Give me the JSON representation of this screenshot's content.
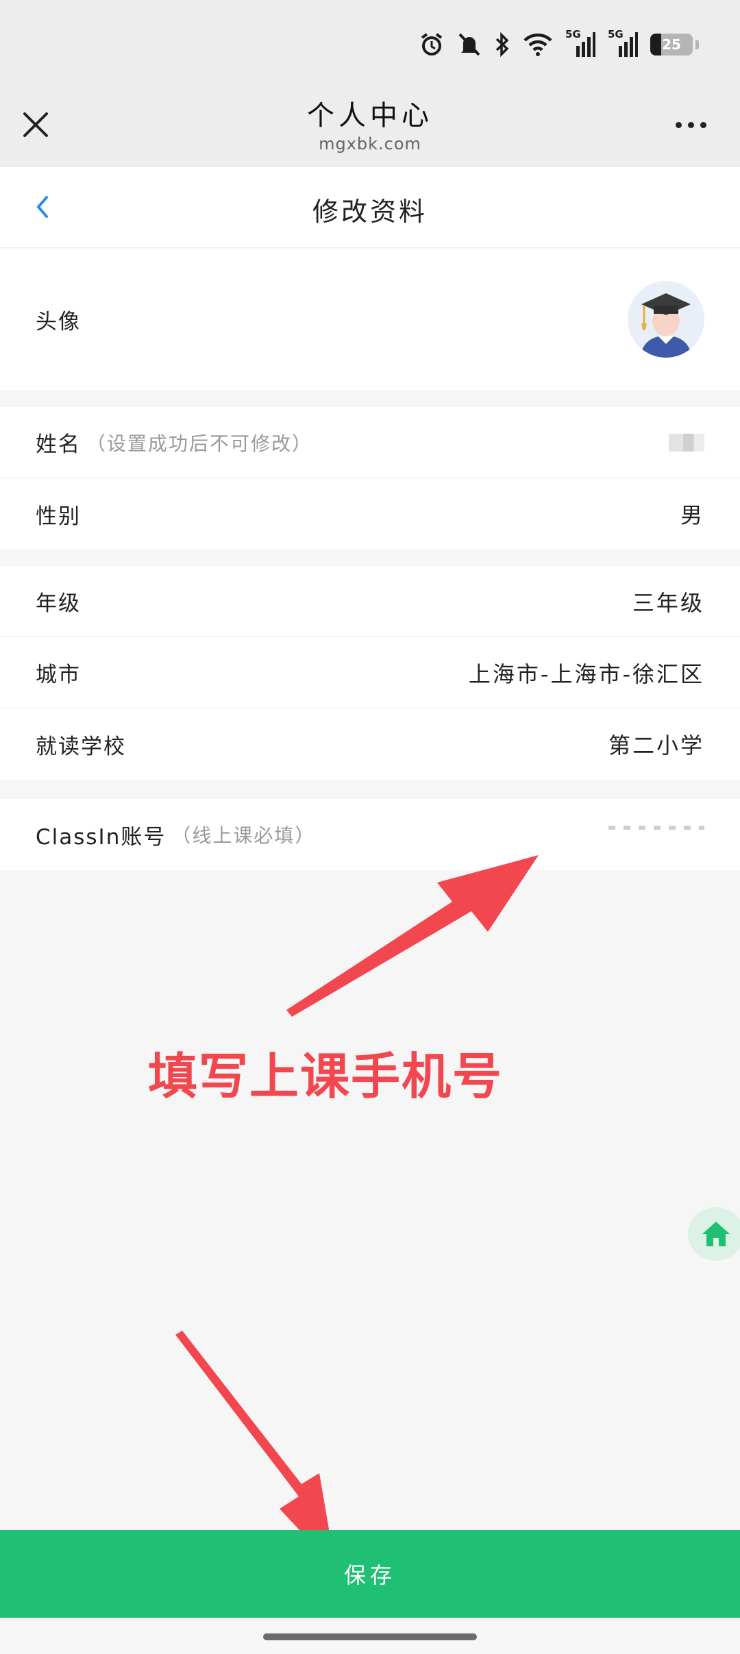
{
  "status_bar": {
    "signal_1_label": "5G",
    "signal_2_label": "5G",
    "battery_level": "25",
    "battery_fraction": 0.25
  },
  "header": {
    "title": "个人中心",
    "subtitle": "mgxbk.com"
  },
  "nav": {
    "title": "修改资料"
  },
  "form": {
    "avatar_label": "头像",
    "name_label": "姓名",
    "name_hint": "（设置成功后不可修改）",
    "gender_label": "性别",
    "gender_value": "男",
    "grade_label": "年级",
    "grade_value": "三年级",
    "city_label": "城市",
    "city_value": "上海市-上海市-徐汇区",
    "school_label": "就读学校",
    "school_value": "第二小学",
    "classin_label": "ClassIn账号",
    "classin_hint": "（线上课必填）"
  },
  "annotation": {
    "text": "填写上课手机号"
  },
  "actions": {
    "save_label": "保存"
  },
  "colors": {
    "accent_green": "#1fbf74",
    "annotation_red": "#f2474f",
    "link_blue": "#2b8ae8"
  }
}
